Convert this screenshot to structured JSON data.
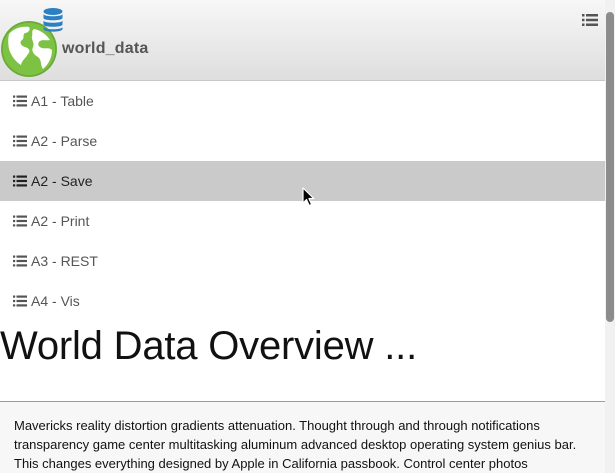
{
  "header": {
    "app_title": "world_data",
    "logo_icon": "globe-icon",
    "database_icon": "database-icon",
    "menu_icon": "list-icon"
  },
  "nav": {
    "items": [
      {
        "label": "A1 - Table",
        "icon": "list-icon",
        "active": false
      },
      {
        "label": "A2 - Parse",
        "icon": "list-icon",
        "active": false
      },
      {
        "label": "A2 - Save",
        "icon": "list-icon",
        "active": true
      },
      {
        "label": "A2 - Print",
        "icon": "list-icon",
        "active": false
      },
      {
        "label": "A3 - REST",
        "icon": "list-icon",
        "active": false
      },
      {
        "label": "A4 - Vis",
        "icon": "list-icon",
        "active": false
      }
    ]
  },
  "main": {
    "title": "World Data Overview ...",
    "body_text": "Mavericks reality distortion gradients attenuation. Thought through and through notifications transparency game center multitasking aluminum advanced desktop operating system genius bar. This changes everything designed by Apple in California passbook. Control center photos"
  },
  "colors": {
    "header_top": "#f7f7f7",
    "header_bottom": "#dedede",
    "active_item": "#cacaca",
    "globe_green": "#7dc243",
    "globe_blue": "#2b7fc3",
    "content_border": "#6cbf5a"
  }
}
